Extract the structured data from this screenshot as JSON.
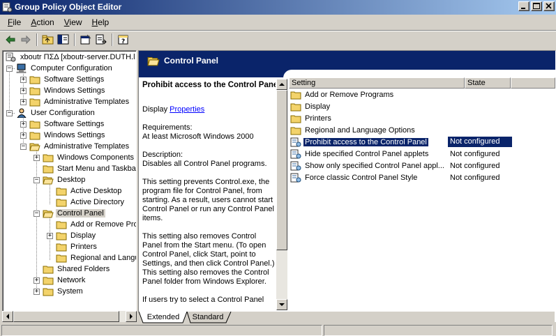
{
  "window": {
    "title": "Group Policy Object Editor"
  },
  "menu": [
    {
      "label": "File",
      "mnemonic": "F",
      "rest": "ile"
    },
    {
      "label": "Action",
      "mnemonic": "A",
      "rest": "ction"
    },
    {
      "label": "View",
      "mnemonic": "V",
      "rest": "iew"
    },
    {
      "label": "Help",
      "mnemonic": "H",
      "rest": "elp"
    }
  ],
  "toolbar": [
    "back-arrow-icon",
    "forward-arrow-icon",
    "up-folder-icon",
    "show-hide-tree-icon",
    "properties-icon",
    "export-list-icon",
    "help-icon"
  ],
  "tree": {
    "root": "xboutr ΠΣΔ [xboutr-server.DUTH.l",
    "computer_config": "Computer Configuration",
    "cc_software": "Software Settings",
    "cc_windows": "Windows Settings",
    "cc_admin": "Administrative Templates",
    "user_config": "User Configuration",
    "uc_software": "Software Settings",
    "uc_windows": "Windows Settings",
    "uc_admin": "Administrative Templates",
    "win_components": "Windows Components",
    "start_menu": "Start Menu and Taskba",
    "desktop": "Desktop",
    "active_desktop": "Active Desktop",
    "active_directory": "Active Directory",
    "control_panel": "Control Panel",
    "add_remove": "Add or Remove Pro",
    "display": "Display",
    "printers": "Printers",
    "regional": "Regional and Langu",
    "shared_folders": "Shared Folders",
    "network": "Network",
    "system": "System"
  },
  "header": {
    "title": "Control Panel"
  },
  "description": {
    "title": "Prohibit access to the Control Panel",
    "display_prefix": "Display ",
    "display_link": "Properties",
    "req_label": "Requirements:",
    "req_value": "At least Microsoft Windows 2000",
    "desc_label": "Description:",
    "desc_value": "Disables all Control Panel programs.",
    "p1": "This setting prevents Control.exe, the program file for Control Panel, from starting. As a result, users cannot start Control Panel or run any Control Panel items.",
    "p2": "This setting also removes Control Panel from the Start menu. (To open Control Panel, click Start, point to Settings, and then click Control Panel.) This setting also removes the Control Panel folder from Windows Explorer.",
    "p3": "If users try to select a Control Panel"
  },
  "list": {
    "col_setting": "Setting",
    "col_state": "State",
    "folders": [
      "Add or Remove Programs",
      "Display",
      "Printers",
      "Regional and Language Options"
    ],
    "settings": [
      {
        "name": "Prohibit access to the Control Panel",
        "state": "Not configured"
      },
      {
        "name": "Hide specified Control Panel applets",
        "state": "Not configured"
      },
      {
        "name": "Show only specified Control Panel appl...",
        "state": "Not configured"
      },
      {
        "name": "Force classic Control Panel Style",
        "state": "Not configured"
      }
    ]
  },
  "tabs": {
    "extended": "Extended",
    "standard": "Standard"
  }
}
